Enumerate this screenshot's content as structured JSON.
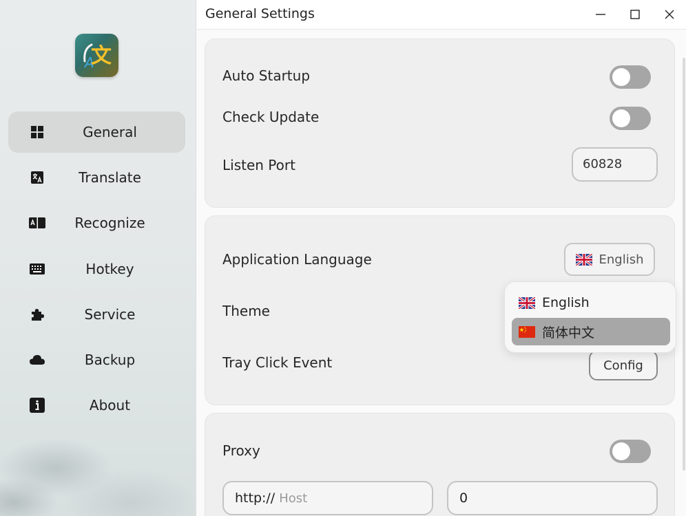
{
  "window": {
    "title": "General Settings"
  },
  "sidebar": {
    "logo_glyph": "文",
    "logo_accent": "A",
    "items": [
      {
        "label": "General",
        "icon": "grid-icon",
        "active": true
      },
      {
        "label": "Translate",
        "icon": "translate-icon",
        "active": false
      },
      {
        "label": "Recognize",
        "icon": "scan-text-icon",
        "active": false
      },
      {
        "label": "Hotkey",
        "icon": "keyboard-icon",
        "active": false
      },
      {
        "label": "Service",
        "icon": "puzzle-icon",
        "active": false
      },
      {
        "label": "Backup",
        "icon": "cloud-icon",
        "active": false
      },
      {
        "label": "About",
        "icon": "info-icon",
        "active": false
      }
    ]
  },
  "general": {
    "auto_startup": {
      "label": "Auto Startup",
      "enabled": false
    },
    "check_update": {
      "label": "Check Update",
      "enabled": false
    },
    "listen_port": {
      "label": "Listen Port",
      "value": "60828"
    }
  },
  "appearance": {
    "app_language": {
      "label": "Application Language",
      "value": "English"
    },
    "theme": {
      "label": "Theme"
    },
    "tray_click": {
      "label": "Tray Click Event",
      "button": "Config"
    }
  },
  "language_dropdown": {
    "options": [
      {
        "label": "English",
        "flag": "uk-flag-icon",
        "selected": false
      },
      {
        "label": "简体中文",
        "flag": "china-flag-icon",
        "selected": true
      }
    ]
  },
  "proxy": {
    "label": "Proxy",
    "enabled": false,
    "scheme": "http://",
    "host_placeholder": "Host",
    "port": "0"
  },
  "colors": {
    "toggle_off": "#a6a6a6",
    "active_nav": "#d7d9d9",
    "card_bg": "#efefef",
    "dropdown_selected": "#a7a7a7"
  }
}
